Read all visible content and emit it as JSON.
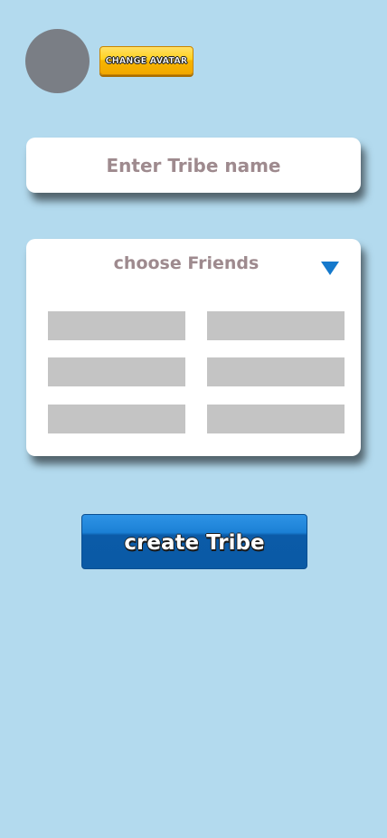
{
  "colors": {
    "background": "#b3daee",
    "avatar_placeholder": "#7a7e85",
    "accent_yellow": "#ffd21e",
    "accent_blue": "#1579cc",
    "label_text": "#9e8a8e",
    "slot_gray": "#c4c4c4"
  },
  "profile": {
    "change_avatar_label": "CHANGE AVATAR"
  },
  "tribe_form": {
    "name_placeholder": "Enter Tribe name",
    "name_value": ""
  },
  "friends": {
    "title": "choose Friends",
    "dropdown_icon": "triangle-down-icon",
    "slots": [
      "",
      "",
      "",
      "",
      "",
      ""
    ]
  },
  "actions": {
    "create_label": "create Tribe"
  }
}
